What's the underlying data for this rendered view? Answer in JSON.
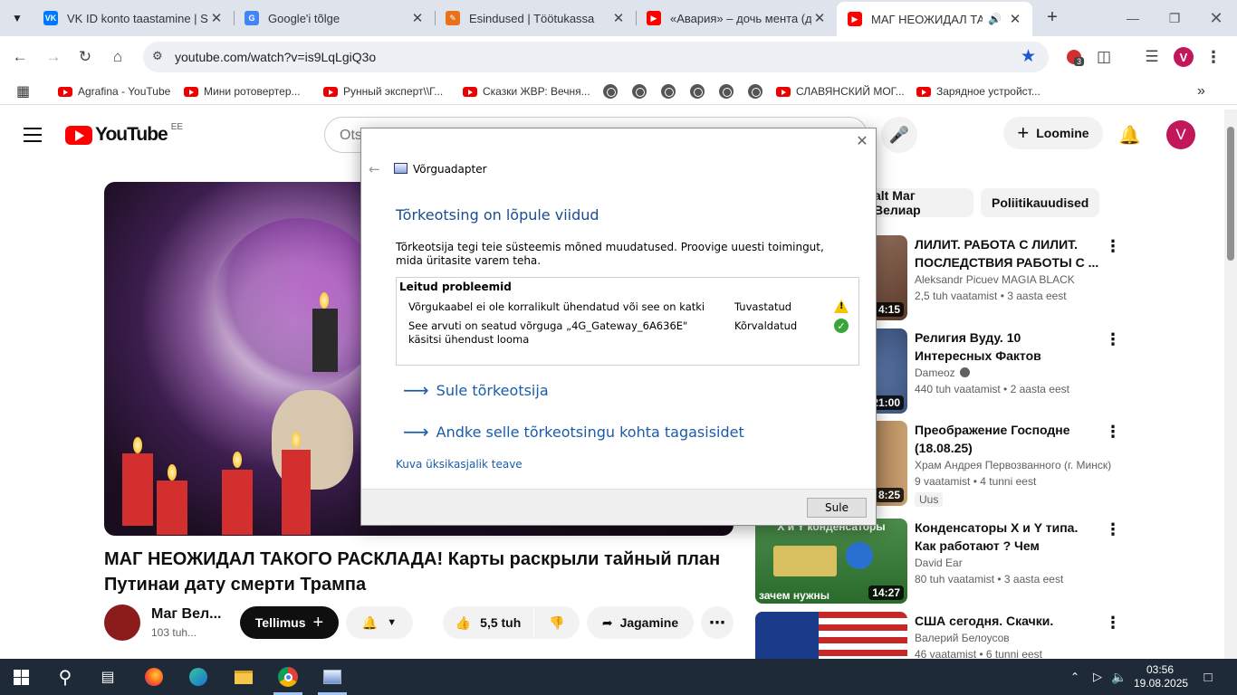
{
  "browser": {
    "tabs": [
      {
        "title": "VK ID konto taastamine | Saì",
        "favicon_color": "#0077ff",
        "favicon_glyph": "VK"
      },
      {
        "title": "Google'i tõlge",
        "favicon_color": "#4285f4",
        "favicon_glyph": "G"
      },
      {
        "title": "Esindused | Töötukassa",
        "favicon_color": "#e8711a",
        "favicon_glyph": "✎"
      },
      {
        "title": "«Авария» – дочь мента (др",
        "favicon_color": "#ff0000",
        "favicon_glyph": "▶"
      },
      {
        "title": "МАГ НЕОЖИДАЛ ТАКО",
        "favicon_color": "#ff0000",
        "favicon_glyph": "▶",
        "active": true
      }
    ],
    "url": "youtube.com/watch?v=is9LqLgiQ3o",
    "extension_badge": "3",
    "profile_initial": "V",
    "bookmarks": [
      {
        "label": "Agrafina - YouTube"
      },
      {
        "label": "Мини ротовертер..."
      },
      {
        "label": "Рунный эксперт\\\\Г..."
      },
      {
        "label": "Сказки ЖВР: Вечня..."
      },
      {
        "label": "СЛАВЯНСКИЙ МОГ..."
      },
      {
        "label": "Зарядное устройст..."
      }
    ]
  },
  "youtube": {
    "logo_word": "YouTube",
    "country_code": "EE",
    "search_placeholder": "Ots",
    "create_label": "Loomine",
    "avatar_initial": "V",
    "chips": [
      "alt Маг Велиар",
      "Poliitikauudised"
    ],
    "video": {
      "title": "МАГ НЕОЖИДАЛ ТАКОГО РАСКЛАДА! Карты раскрыли тайный план Путинаи дату смерти Трампа",
      "channel_name": "Маг Вел...",
      "channel_subs": "103 tuh...",
      "subscribe_label": "Tellimus",
      "likes": "5,5 tuh",
      "share_label": "Jagamine"
    },
    "recommendations": [
      {
        "title": "ЛИЛИТ. РАБОТА С ЛИЛИТ. ПОСЛЕДСТВИЯ РАБОТЫ С ...",
        "channel": "Aleksandr Picuev MAGIA BLACK",
        "meta": "2,5 tuh vaatamist • 3 aasta eest",
        "duration": "4:15",
        "thumb_color": "#7a5a4a"
      },
      {
        "title": "Религия Вуду. 10 Интересных Фактов",
        "channel": "Dameoz",
        "meta": "440 tuh vaatamist • 2 aasta eest",
        "duration": "21:00",
        "thumb_color": "#2a4a7a"
      },
      {
        "title": "Преображение Господне (18.08.25)",
        "channel": "Храм Андрея Первозванного (г. Минск)",
        "meta": "9 vaatamist • 4 tunni eest",
        "duration": "8:25",
        "badge": "Uus",
        "thumb_color": "#5a4030"
      },
      {
        "title": "Конденсаторы X и Y типа. Как работают ? Чем отличаются ...",
        "channel": "David Ear",
        "meta": "80 tuh vaatamist • 3 aasta eest",
        "duration": "14:27",
        "thumb_color": "#3a7a3a",
        "thumb_top_text": "X и Y конденсаторы",
        "thumb_bottom_text": "зачем нужны"
      },
      {
        "title": "США сегодня. Скачки.",
        "channel": "Валерий Белоусов",
        "meta": "46 vaatamist • 6 tunni eest",
        "thumb_color": "#3550a0"
      }
    ]
  },
  "dialog": {
    "app_title": "Võrguadapter",
    "heading": "Tõrkeotsing on lõpule viidud",
    "description": "Tõrkeotsija tegi teie süsteemis mõned muudatused. Proovige uuesti toimingut, mida üritasite varem teha.",
    "problems_header": "Leitud probleemid",
    "problems": [
      {
        "description": "Võrgukaabel ei ole korralikult ühendatud või see on katki",
        "status": "Tuvastatud",
        "icon": "warning-icon"
      },
      {
        "description": "See arvuti on seatud võrguga „4G_Gateway_6A636E\" käsitsi ühendust looma",
        "status": "Kõrvaldatud",
        "icon": "check-icon"
      }
    ],
    "link_close": "Sule tõrkeotsija",
    "link_feedback": "Andke selle tõrkeotsingu kohta tagasisidet",
    "details_link": "Kuva üksikasjalik teave",
    "close_button": "Sule"
  },
  "taskbar": {
    "time": "03:56",
    "date": "19.08.2025"
  }
}
